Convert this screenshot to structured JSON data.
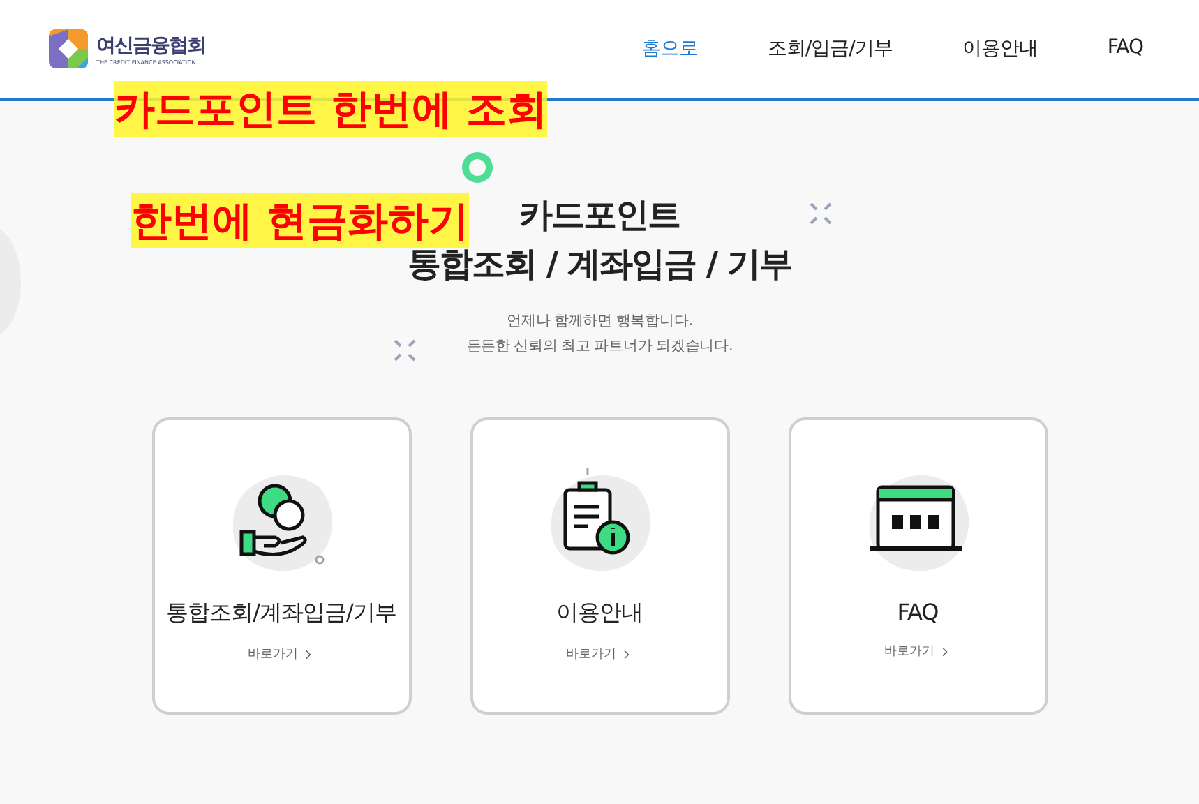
{
  "header": {
    "logo": {
      "name": "여신금융협회",
      "tagline": "THE CREDIT FINANCE ASSOCIATION"
    },
    "nav": [
      {
        "label": "홈으로",
        "selected": true
      },
      {
        "label": "조회/입금/기부",
        "selected": false
      },
      {
        "label": "이용안내",
        "selected": false
      },
      {
        "label": "FAQ",
        "selected": false
      }
    ]
  },
  "hero": {
    "title_lines": [
      "카드포인트",
      "통합조회 / 계좌입금 / 기부"
    ],
    "subtitle_lines": [
      "언제나 함께하면 행복합니다.",
      "든든한 신뢰의 최고 파트너가 되겠습니다."
    ]
  },
  "cards": [
    {
      "kind": "coins",
      "title": "통합조회/계좌입금/기부",
      "link": "바로가기"
    },
    {
      "kind": "guide",
      "title": "이용안내",
      "link": "바로가기"
    },
    {
      "kind": "faq",
      "title": "FAQ",
      "link": "바로가기"
    }
  ],
  "annotation": {
    "lines": [
      "카드포인트 한번에 조회",
      "한번에 현금화하기"
    ]
  }
}
